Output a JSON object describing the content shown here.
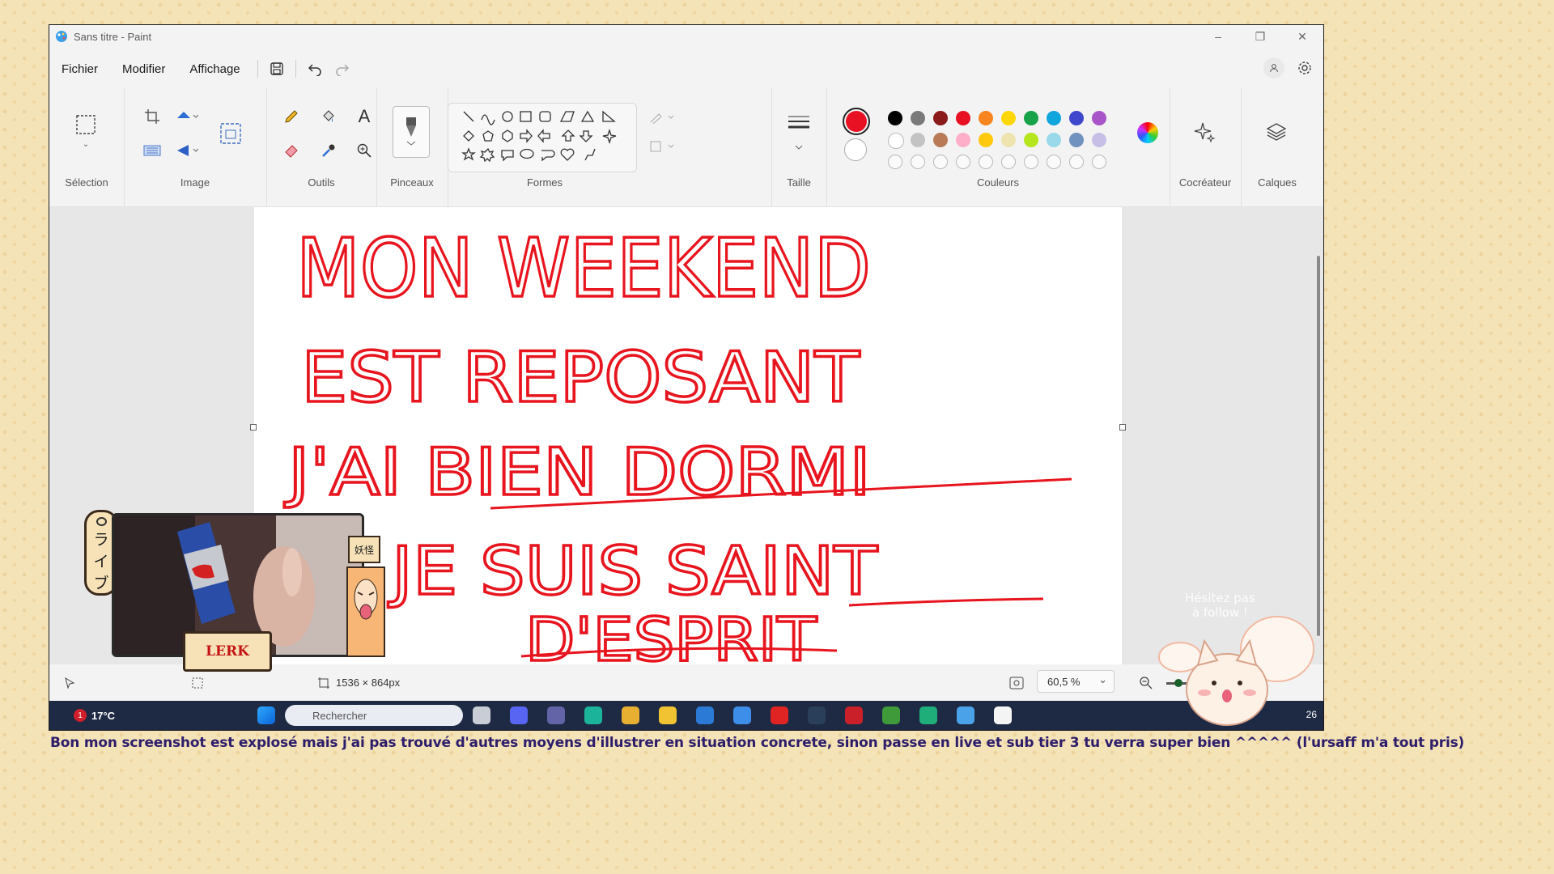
{
  "window": {
    "title": "Sans titre - Paint",
    "controls": {
      "minimize": "–",
      "maximize": "❐",
      "close": "✕"
    }
  },
  "menu": {
    "items": [
      "Fichier",
      "Modifier",
      "Affichage"
    ]
  },
  "ribbon": {
    "groups": {
      "selection": "Sélection",
      "image": "Image",
      "outils": "Outils",
      "pinceaux": "Pinceaux",
      "formes": "Formes",
      "taille": "Taille",
      "couleurs": "Couleurs",
      "cocreateur": "Cocréateur",
      "calques": "Calques"
    },
    "text_tool": "A",
    "primary_color": "#e81123",
    "palette_row1": [
      "#000000",
      "#7a7a7a",
      "#8b1a1a",
      "#e81123",
      "#f7841f",
      "#ffd700",
      "#16a34a",
      "#10a5dc",
      "#3f48cc",
      "#a855c9"
    ],
    "palette_row2": [
      "#ffffff",
      "#c3c3c3",
      "#b97a57",
      "#ffaec9",
      "#ffc90e",
      "#efe4b0",
      "#b5e61d",
      "#99d9ea",
      "#7092be",
      "#c8bfe7"
    ]
  },
  "canvas": {
    "drawing_text": [
      "MON WEEKEND",
      "EST REPOSANT",
      "J'AI BIEN DORMI",
      "JE SUIS SAINT",
      "D'ESPRIT"
    ],
    "ink_color": "#e8141e"
  },
  "status": {
    "dimensions": "1536 × 864px",
    "zoom": "60,5 %"
  },
  "taskbar": {
    "weather": "17°C",
    "notification_count": "1",
    "search_placeholder": "Rechercher",
    "time_fragment": "26"
  },
  "overlay": {
    "live_tag": [
      "ラ",
      "イ",
      "ブ"
    ],
    "lerk_label": "LERK",
    "yokai_label": "妖怪",
    "follow_text": [
      "Hésitez pas",
      "à follow !"
    ]
  },
  "caption": "Bon mon screenshot est explosé mais j'ai pas trouvé d'autres moyens d'illustrer en situation concrete, sinon passe en live et sub tier 3 tu verra super bien ^^^^^ (l'ursaff m'a tout pris)"
}
